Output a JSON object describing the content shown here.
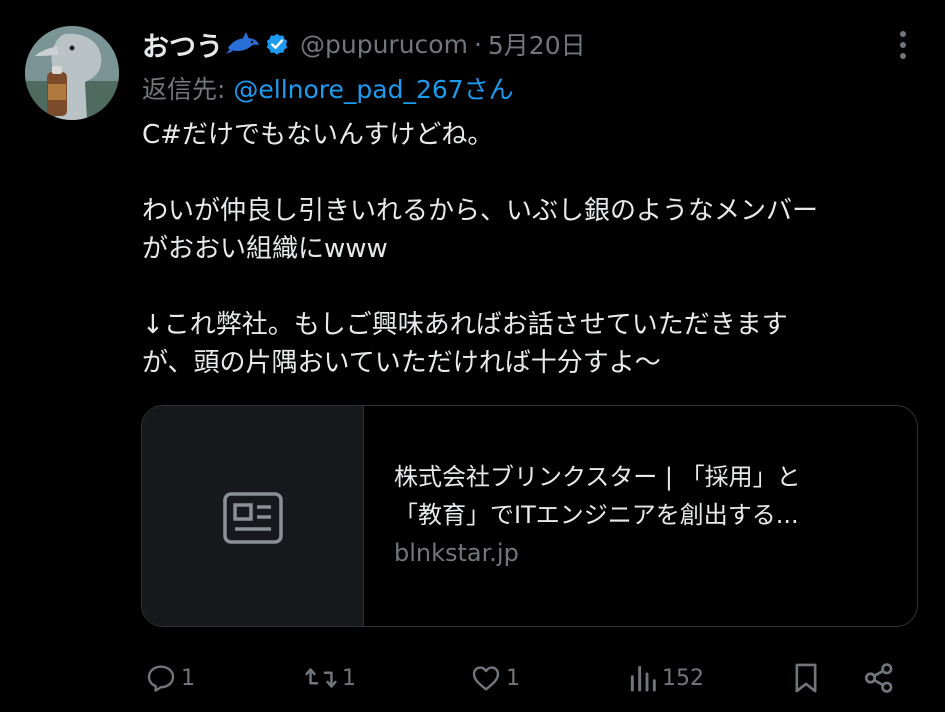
{
  "author": {
    "display_name": "おつう",
    "handle": "@pupurucom",
    "separator": "·",
    "date": "5月20日",
    "avatar_icon": "dolphin-avatar",
    "emoji_icon": "dolphin-emoji-icon",
    "verified_icon": "verified-badge-icon"
  },
  "reply": {
    "prefix": "返信先: ",
    "mention": "@ellnore_pad_267さん"
  },
  "text": {
    "line1": "C#だけでもないんすけどね。",
    "line2": "わいが仲良し引きいれるから、いぶし銀のようなメンバー",
    "line3": "がおおい組織にwww",
    "line4": "↓これ弊社。もしご興味あればお話させていただきます",
    "line5": "が、頭の片隅おいていただければ十分すよ〜"
  },
  "card": {
    "title_line1": "株式会社ブリンクスター | 「採用」と",
    "title_line2": "「教育」でITエンジニアを創出する...",
    "domain": "blnkstar.jp",
    "thumb_icon": "article-icon"
  },
  "actions": {
    "replies": "1",
    "reposts": "1",
    "likes": "1",
    "views": "152"
  },
  "colors": {
    "background": "#000000",
    "text": "#e7e9ea",
    "secondary": "#71767b",
    "link": "#1d9bf0",
    "border": "#2f3336"
  }
}
